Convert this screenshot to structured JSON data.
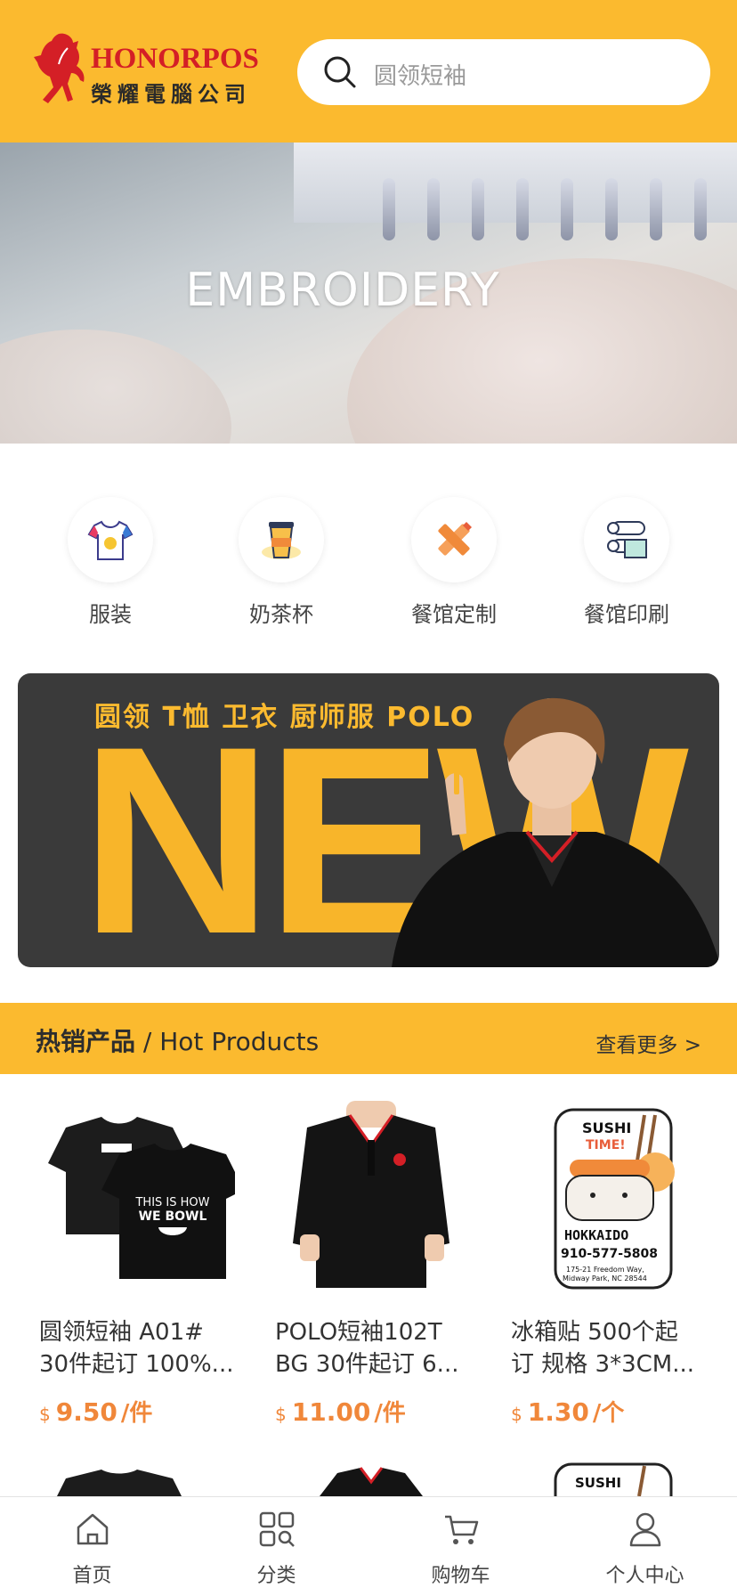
{
  "header": {
    "logo_top": "HONORPOS",
    "logo_bottom": "榮耀電腦公司",
    "search_placeholder": "圆领短袖",
    "accent_color": "#FBBA2F"
  },
  "banner": {
    "title": "EMBROIDERY",
    "slide_count": 4,
    "active_slide": 2
  },
  "categories": [
    {
      "label": "服装",
      "icon": "tshirt-icon"
    },
    {
      "label": "奶茶杯",
      "icon": "cup-icon"
    },
    {
      "label": "餐馆定制",
      "icon": "pencil-ruler-icon"
    },
    {
      "label": "餐馆印刷",
      "icon": "paper-roll-icon"
    }
  ],
  "promo": {
    "line": "圆领 T恤 卫衣 厨师服 POLO",
    "big_text": "NEW"
  },
  "hot": {
    "title_cn": "热销产品",
    "title_en": " / Hot Products",
    "more": "查看更多 >"
  },
  "products": [
    {
      "name_line1": "圆领短袖  A01#",
      "name_line2": "30件起订 100%...",
      "currency": "$",
      "price": "9.50",
      "unit": "/件",
      "image": "black-tshirt"
    },
    {
      "name_line1": "POLO短袖102T",
      "name_line2": "BG 30件起订 6...",
      "currency": "$",
      "price": "11.00",
      "unit": "/件",
      "image": "black-polo"
    },
    {
      "name_line1": "冰箱贴 500个起",
      "name_line2": "订 规格 3*3CM...",
      "currency": "$",
      "price": "1.30",
      "unit": "/个",
      "image": "sushi-magnet"
    }
  ],
  "tabbar": [
    {
      "label": "首页",
      "icon": "home-icon"
    },
    {
      "label": "分类",
      "icon": "category-grid-icon"
    },
    {
      "label": "购物车",
      "icon": "cart-icon"
    },
    {
      "label": "个人中心",
      "icon": "user-icon"
    }
  ]
}
